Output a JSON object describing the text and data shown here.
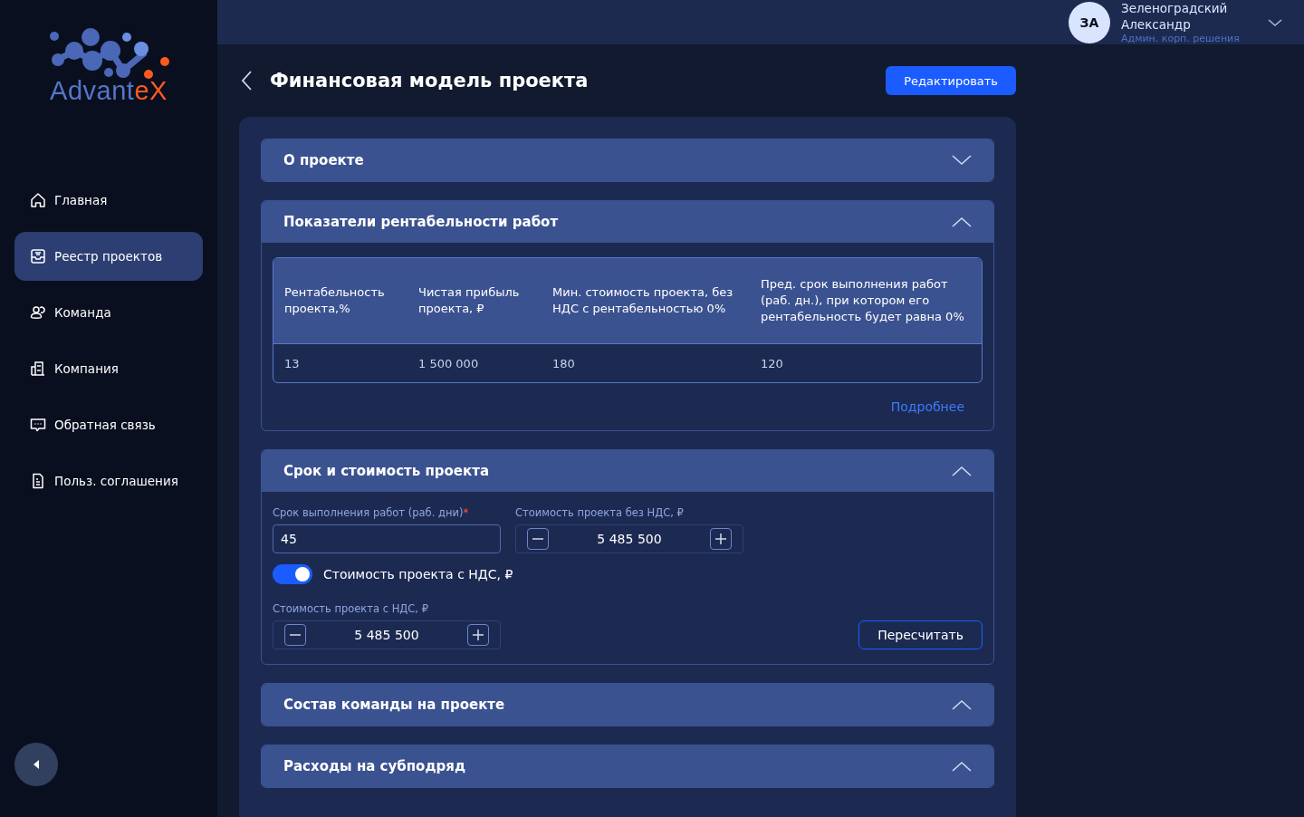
{
  "logo": {
    "text_primary": "Advant",
    "text_accent": "eX"
  },
  "sidebar": {
    "items": [
      {
        "label": "Главная",
        "kind": "home",
        "selected": false
      },
      {
        "label": "Реестр проектов",
        "kind": "inbox",
        "selected": true
      },
      {
        "label": "Команда",
        "kind": "users",
        "selected": false
      },
      {
        "label": "Компания",
        "kind": "building",
        "selected": false
      },
      {
        "label": "Обратная связь",
        "kind": "chat",
        "selected": false
      },
      {
        "label": "Польз. соглашения",
        "kind": "doc",
        "selected": false
      }
    ]
  },
  "user": {
    "initials": "ЗА",
    "name": "Зеленоградский Александр",
    "role": "Админ. корп. решения"
  },
  "page": {
    "title": "Финансовая модель проекта",
    "edit_button": "Редактировать"
  },
  "sections": [
    {
      "title": "О проекте",
      "expanded": false
    },
    {
      "title": "Показатели рентабельности работ",
      "expanded": true,
      "kind": "table",
      "table": {
        "columns": [
          "Рентабельность проекта,%",
          "Чистая прибыль проекта, ₽",
          "Мин. стоимость проекта, без НДС с рентабельностью 0%",
          "Пред. срок выполнения работ (раб. дн.), при котором его рентабельность будет равна 0%"
        ],
        "rows": [
          [
            "13",
            "1 500 000",
            "180",
            "120"
          ]
        ]
      },
      "link": "Подробнее"
    },
    {
      "title": "Срок и стоимость проекта",
      "expanded": true,
      "kind": "form",
      "term_field": {
        "label": "Срок выполнения работ (раб. дни)",
        "required_mark": "*",
        "value": "45"
      },
      "cost_no_vat": {
        "label": "Стоимость проекта без НДС, ₽",
        "value": "5 485 500"
      },
      "vat_toggle": {
        "label": "Стоимость проекта с НДС, ₽",
        "on": true
      },
      "cost_vat": {
        "label": "Стоимость проекта с НДС, ₽",
        "value": "5 485 500"
      },
      "recalc_button": "Пересчитать"
    },
    {
      "title": "Состав команды на проекте",
      "expanded": true
    },
    {
      "title": "Расходы на субподряд",
      "expanded": true
    }
  ]
}
